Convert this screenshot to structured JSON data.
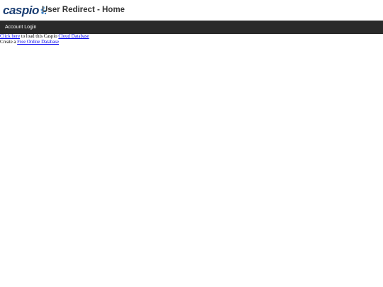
{
  "header": {
    "logo_text": "caspio",
    "title": "User Redirect - Home",
    "colors": {
      "logo_text": "#1c3f73",
      "logo_dots": [
        "#3b7fc4",
        "#5aa0dc",
        "#8cc0ea"
      ],
      "title": "#333333"
    }
  },
  "nav": {
    "background": "#2a2a2a",
    "items": [
      {
        "label": "Account Login"
      }
    ]
  },
  "content": {
    "line1": {
      "link1": "Click here",
      "text1": " to load this Caspio ",
      "link2": "Cloud Database"
    },
    "line2": {
      "text1": "Create a ",
      "link1": "Free Online Database"
    }
  }
}
